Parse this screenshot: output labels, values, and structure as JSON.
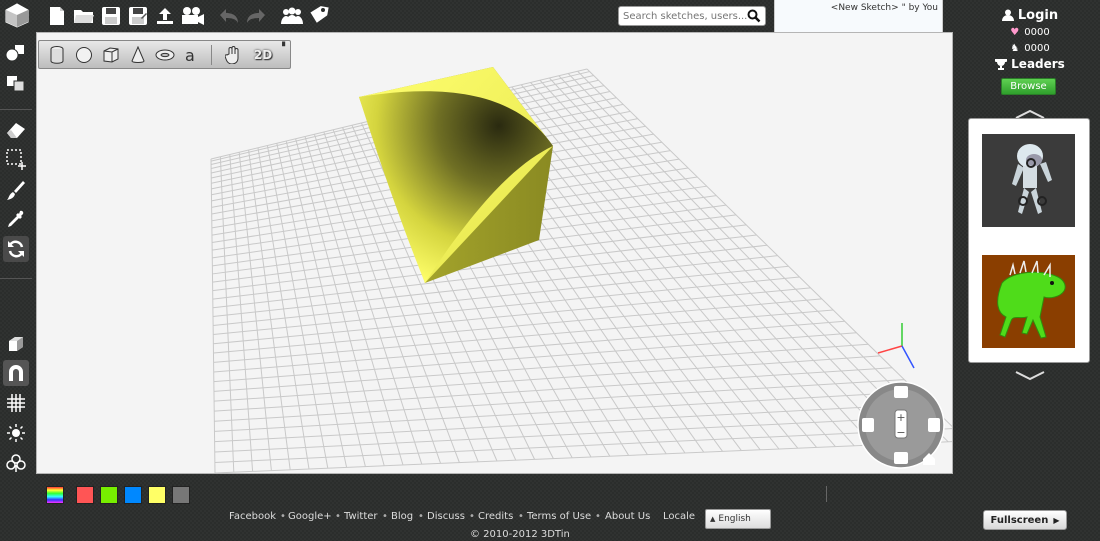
{
  "toolbar": {
    "icons": [
      "new-sketch-icon",
      "open-folder-icon",
      "save-icon",
      "save-as-icon",
      "upload-icon",
      "video-camera-icon",
      "undo-icon",
      "redo-icon",
      "users-icon",
      "tag-icon"
    ]
  },
  "search": {
    "placeholder": "Search sketches, users..."
  },
  "sketch": {
    "name": "<New Sketch>",
    "separator": "\"",
    "by_text": "by You"
  },
  "shape_toolbar": {
    "items": [
      "cylinder",
      "sphere",
      "box",
      "cone",
      "torus",
      "text",
      "hand",
      "2D"
    ],
    "mode_label": "2D"
  },
  "left_tools": [
    "shapes-icon",
    "layers-icon",
    "eraser-icon",
    "select-icon",
    "paint-brush-icon",
    "eyedropper-icon",
    "refresh-icon",
    "cube-view-icon",
    "magnet-icon",
    "grid-icon",
    "light-icon",
    "club-icon"
  ],
  "account": {
    "login_label": "Login",
    "stat_1": "0000",
    "stat_2": "0000",
    "leaders_label": "Leaders",
    "browse_label": "Browse"
  },
  "palette": {
    "colors": [
      "#ff5555",
      "#77ee00",
      "#0088ff",
      "#ffff66",
      "#777777"
    ]
  },
  "footer": {
    "links": [
      "Facebook",
      "Google+",
      "Twitter",
      "Blog",
      "Discuss",
      "Credits",
      "Terms of Use",
      "About Us"
    ],
    "locale_label": "Locale",
    "locale_value": "English",
    "fullscreen_label": "Fullscreen",
    "copyright": "© 2010-2012 3DTin"
  },
  "colors": {
    "accent_green": "#3cb43a",
    "object_yellow": "#ffff66",
    "viewport_bg": "#f4f4f4"
  }
}
